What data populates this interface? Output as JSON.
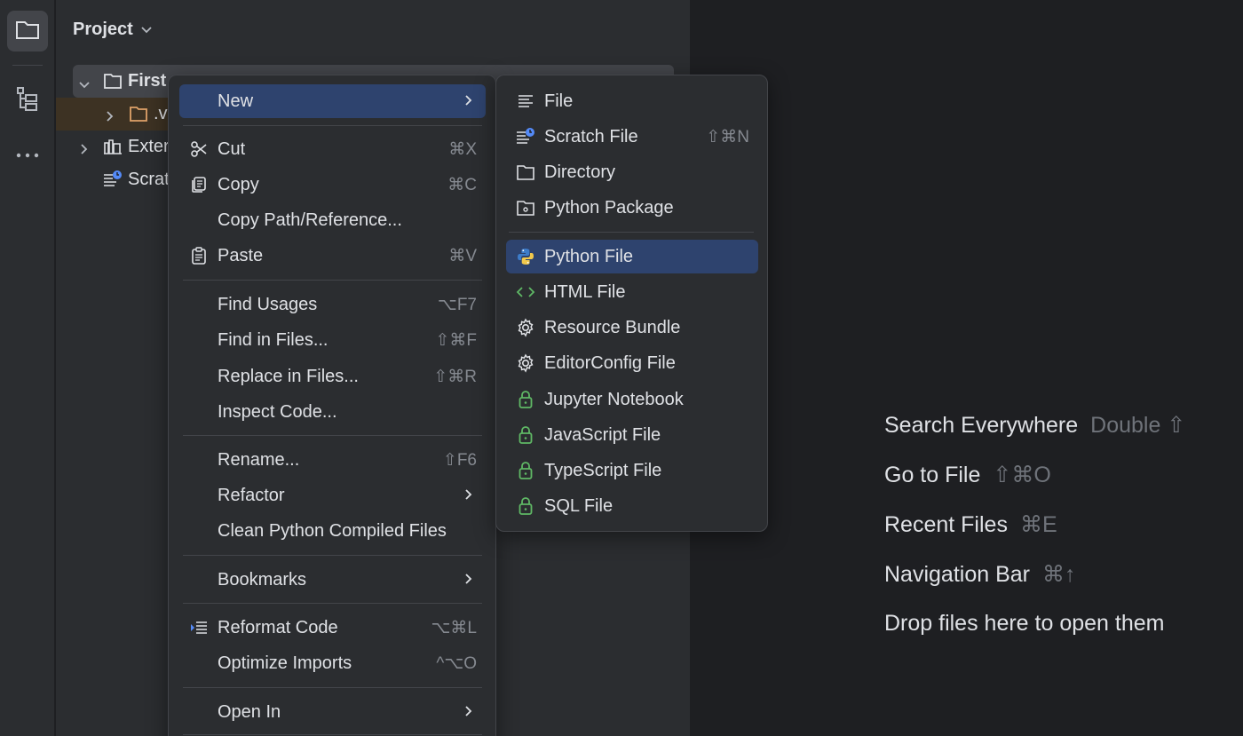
{
  "project_panel": {
    "title": "Project",
    "tree": [
      {
        "label": "First",
        "icon": "folder-icon"
      },
      {
        "label": ".v",
        "icon": "folder-icon-orange"
      },
      {
        "label": "Exter",
        "icon": "library-icon"
      },
      {
        "label": "Scrat",
        "icon": "scratch-icon"
      }
    ]
  },
  "context_menu": {
    "items": [
      {
        "label": "New",
        "shortcut": "",
        "submenu": true
      },
      {
        "label": "Cut",
        "shortcut": "⌘X"
      },
      {
        "label": "Copy",
        "shortcut": "⌘C"
      },
      {
        "label": "Copy Path/Reference...",
        "shortcut": ""
      },
      {
        "label": "Paste",
        "shortcut": "⌘V"
      },
      {
        "label": "Find Usages",
        "shortcut": "⌥F7"
      },
      {
        "label": "Find in Files...",
        "shortcut": "⇧⌘F"
      },
      {
        "label": "Replace in Files...",
        "shortcut": "⇧⌘R"
      },
      {
        "label": "Inspect Code...",
        "shortcut": ""
      },
      {
        "label": "Rename...",
        "shortcut": "⇧F6"
      },
      {
        "label": "Refactor",
        "shortcut": "",
        "submenu": true
      },
      {
        "label": "Clean Python Compiled Files",
        "shortcut": ""
      },
      {
        "label": "Bookmarks",
        "shortcut": "",
        "submenu": true
      },
      {
        "label": "Reformat Code",
        "shortcut": "⌥⌘L"
      },
      {
        "label": "Optimize Imports",
        "shortcut": "^⌥O"
      },
      {
        "label": "Open In",
        "shortcut": "",
        "submenu": true
      }
    ]
  },
  "new_submenu": {
    "items": [
      {
        "label": "File",
        "shortcut": ""
      },
      {
        "label": "Scratch File",
        "shortcut": "⇧⌘N"
      },
      {
        "label": "Directory",
        "shortcut": ""
      },
      {
        "label": "Python Package",
        "shortcut": ""
      },
      {
        "label": "Python File",
        "shortcut": ""
      },
      {
        "label": "HTML File",
        "shortcut": ""
      },
      {
        "label": "Resource Bundle",
        "shortcut": ""
      },
      {
        "label": "EditorConfig File",
        "shortcut": ""
      },
      {
        "label": "Jupyter Notebook",
        "shortcut": ""
      },
      {
        "label": "JavaScript File",
        "shortcut": ""
      },
      {
        "label": "TypeScript File",
        "shortcut": ""
      },
      {
        "label": "SQL File",
        "shortcut": ""
      }
    ]
  },
  "editor_hints": [
    {
      "label": "Search Everywhere",
      "key": "Double ⇧"
    },
    {
      "label": "Go to File",
      "key": "⇧⌘O"
    },
    {
      "label": "Recent Files",
      "key": "⌘E"
    },
    {
      "label": "Navigation Bar",
      "key": "⌘↑"
    },
    {
      "label": "Drop files here to open them",
      "key": ""
    }
  ],
  "colors": {
    "background": "#1e1f22",
    "panel": "#2b2d30",
    "selection": "#2e436e",
    "text": "#dfe1e5",
    "muted": "#868a91",
    "lock_green": "#5fb865"
  }
}
